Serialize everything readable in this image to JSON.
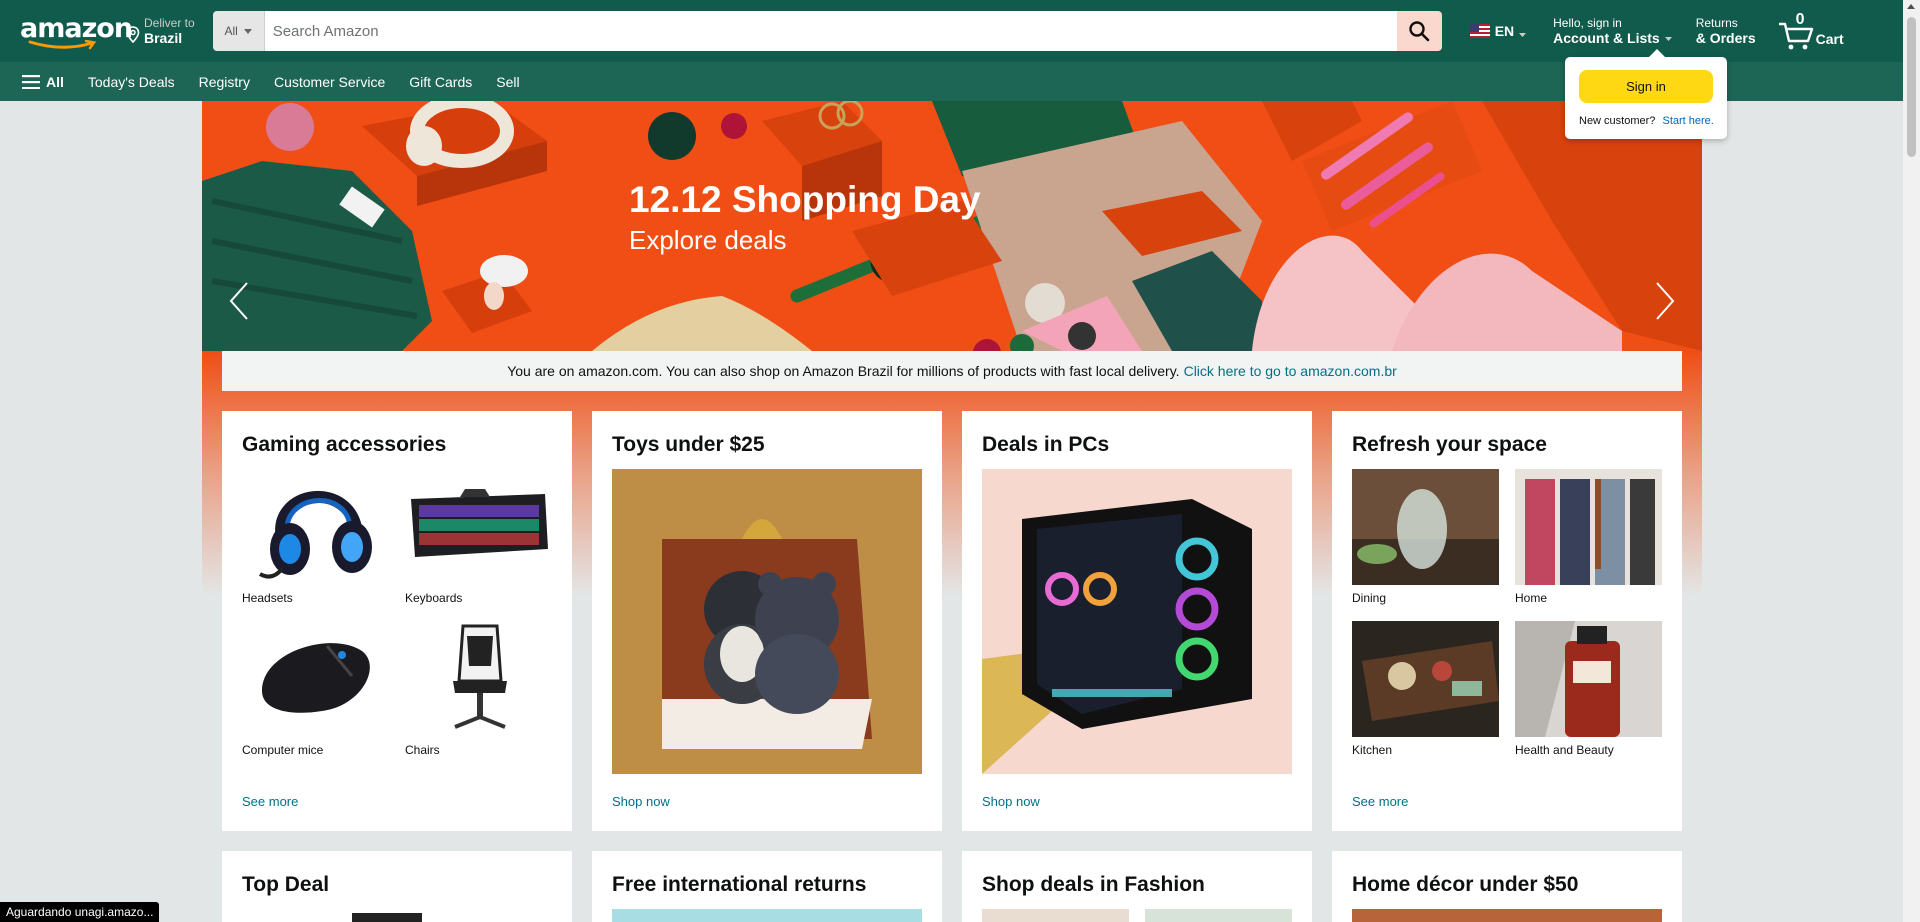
{
  "header": {
    "logo_text": "amazon",
    "deliver_line1": "Deliver to",
    "deliver_line2": "Brazil",
    "search_dept": "All",
    "search_placeholder": "Search Amazon",
    "language": "EN",
    "account_line1": "Hello, sign in",
    "account_line2": "Account & Lists",
    "returns_line1": "Returns",
    "returns_line2": "& Orders",
    "cart_count": "0",
    "cart_label": "Cart"
  },
  "subnav": {
    "all_label": "All",
    "links": [
      "Today's Deals",
      "Registry",
      "Customer Service",
      "Gift Cards",
      "Sell"
    ]
  },
  "hero": {
    "title": "12.12 Shopping Day",
    "subtitle": "Explore deals"
  },
  "notice": {
    "text": "You are on amazon.com. You can also shop on Amazon Brazil for millions of products with fast local delivery.",
    "link": "Click here to go to amazon.com.br"
  },
  "signin_flyout": {
    "button": "Sign in",
    "new_customer": "New customer?",
    "start_here": "Start here."
  },
  "cards": [
    {
      "title": "Gaming accessories",
      "items": [
        "Headsets",
        "Keyboards",
        "Computer mice",
        "Chairs"
      ],
      "link": "See more"
    },
    {
      "title": "Toys under $25",
      "link": "Shop now"
    },
    {
      "title": "Deals in PCs",
      "link": "Shop now"
    },
    {
      "title": "Refresh your space",
      "items": [
        "Dining",
        "Home",
        "Kitchen",
        "Health and Beauty"
      ],
      "link": "See more"
    }
  ],
  "cards_row2": [
    "Top Deal",
    "Free international returns",
    "Shop deals in Fashion",
    "Home décor under $50"
  ],
  "status_bar": "Aguardando unagi.amazo...",
  "colors": {
    "nav_belt": "#115b4d",
    "nav_main": "#1d6554",
    "hero_bg": "#f04e14",
    "sign_in_button": "#ffd814",
    "link": "#007185"
  }
}
